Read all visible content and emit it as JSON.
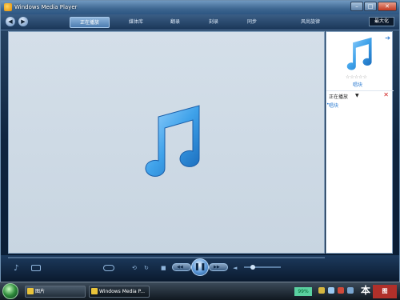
{
  "titlebar": {
    "title": "Windows Media Player"
  },
  "navbar": {
    "back_glyph": "◀",
    "forward_glyph": "▶",
    "tabs": [
      {
        "label": "正在播放"
      },
      {
        "label": "媒体库"
      },
      {
        "label": "翻录"
      },
      {
        "label": "刻录"
      },
      {
        "label": "同步"
      },
      {
        "label": "风尚旋律"
      }
    ],
    "maximize_label": "最大化"
  },
  "right_panel": {
    "stars": "☆☆☆☆☆",
    "album_label": "唱块",
    "now_playing_label": "正在播放",
    "dropdown_glyph": "▼",
    "close_glyph": "✕",
    "items": [
      {
        "label": "唱块"
      }
    ]
  },
  "controls": {
    "shuffle": "⟲",
    "repeat": "↻",
    "stop_glyph": "■",
    "prev_glyph": "◀◀",
    "play_glyph": "❚❚",
    "next_glyph": "▶▶",
    "mute_glyph": "◄",
    "volume_level": 0.18
  },
  "taskbar": {
    "tasks": [
      {
        "label": "图片"
      },
      {
        "label": "Windows Media P..."
      }
    ],
    "lang_label": "99%"
  },
  "colors": {
    "accent": "#4a9ee0",
    "note": "#3fa2ea"
  }
}
